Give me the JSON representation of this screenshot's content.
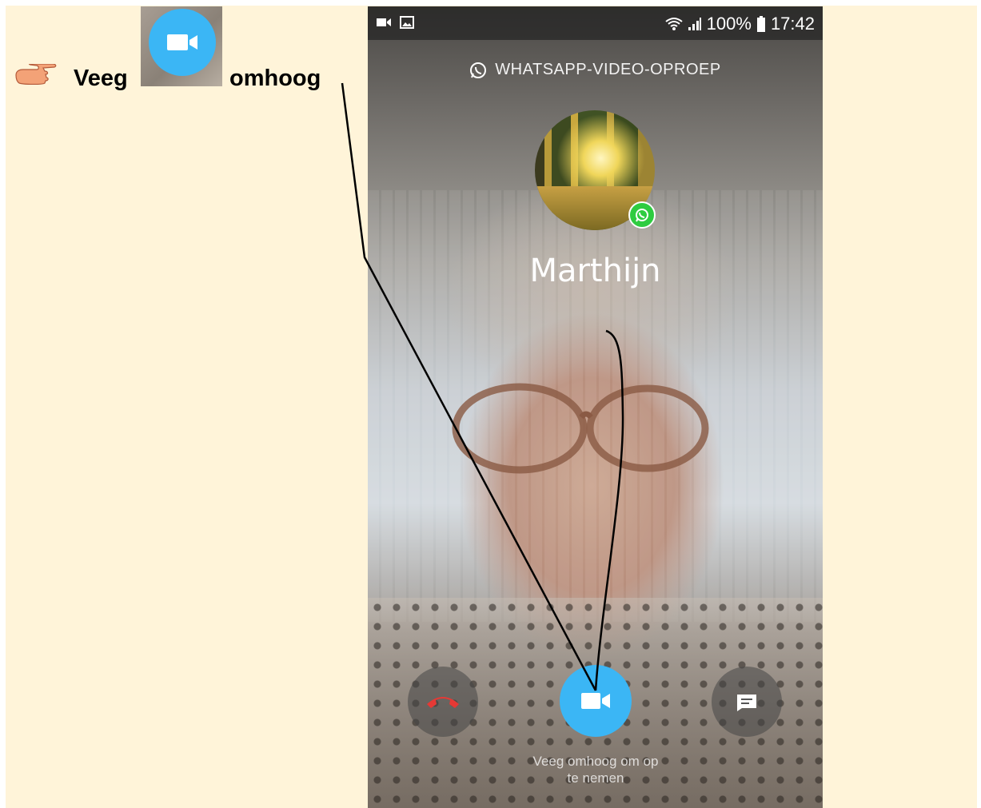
{
  "instruction": {
    "word_before": "Veeg",
    "word_after": "omhoog",
    "hand_icon": "pointing-hand-icon",
    "thumbnail_icon": "video-camera-icon"
  },
  "phone": {
    "status_bar": {
      "left_icons": [
        "video-notification-icon",
        "image-notification-icon"
      ],
      "right_icons": [
        "wifi-icon",
        "signal-icon",
        "battery-icon"
      ],
      "battery": "100%",
      "time": "17:42"
    },
    "call_type_label": "WHATSAPP-VIDEO-OPROEP",
    "call_type_icon": "whatsapp-icon",
    "contact_name": "Marthijn",
    "avatar_badge_icon": "whatsapp-icon",
    "buttons": {
      "decline_icon": "phone-hangup-icon",
      "accept_icon": "video-camera-icon",
      "message_icon": "message-icon"
    },
    "hint_line1": "Veeg omhoog om op",
    "hint_line2": "te nemen"
  },
  "colors": {
    "page_background": "#fff4d9",
    "accept_button": "#3bb6f5",
    "decline_icon": "#e53935",
    "whatsapp_green": "#2ecc40"
  }
}
